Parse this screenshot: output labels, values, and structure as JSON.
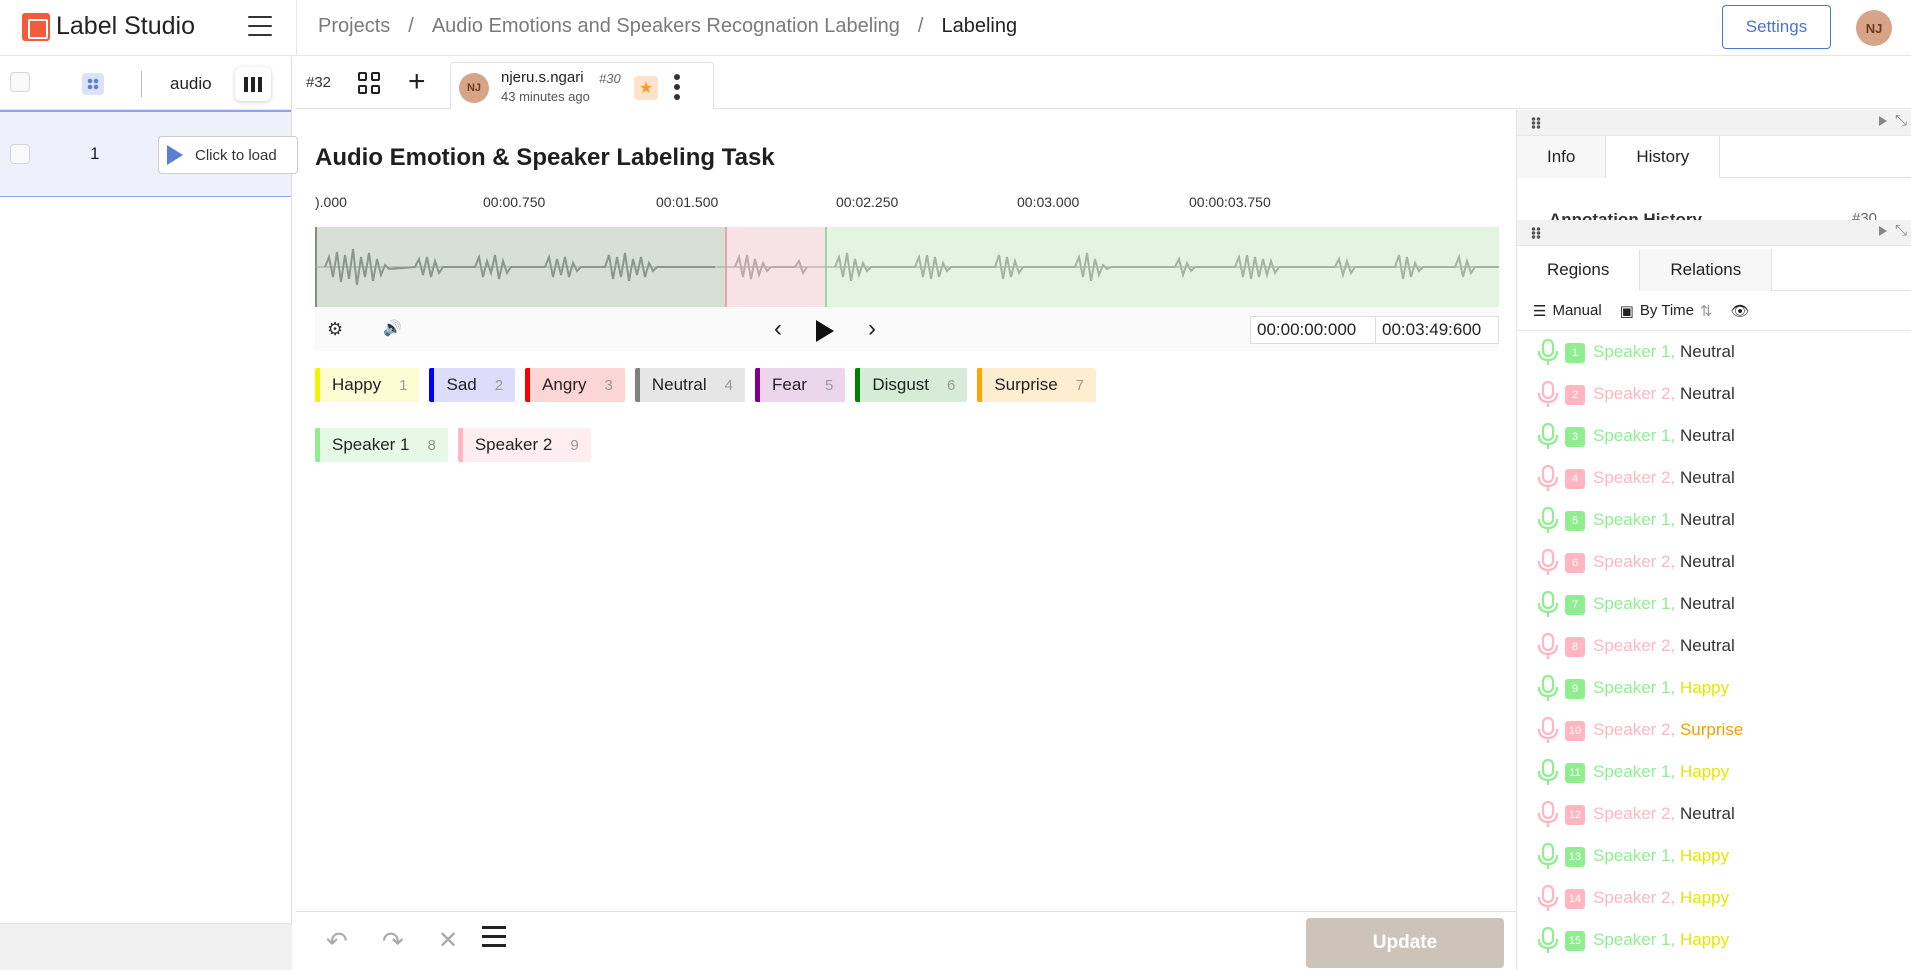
{
  "header": {
    "brand": "Label Studio",
    "breadcrumb": [
      "Projects",
      "Audio Emotions and Speakers Recognation Labeling",
      "Labeling"
    ],
    "settings_label": "Settings",
    "user_initials": "NJ"
  },
  "left_panel": {
    "column_label": "audio",
    "rows": [
      {
        "num": "1",
        "load_label": "Click to load"
      }
    ]
  },
  "annotation_bar": {
    "task_id": "#32",
    "annotator": "njeru.s.ngari",
    "annotation_id": "#30",
    "time": "43 minutes ago",
    "initials": "NJ"
  },
  "main": {
    "title": "Audio Emotion & Speaker Labeling Task",
    "timeline_labels": [
      ").000",
      "00:00.750",
      "00:01.500",
      "00:02.250",
      "00:03.000",
      "00:00:03.750"
    ],
    "time_current": "00:00:00:000",
    "time_total": "00:03:49:600"
  },
  "emotion_labels": [
    {
      "name": "Happy",
      "hotkey": "1",
      "color": "#f4f400",
      "bg": "#fdfdd4"
    },
    {
      "name": "Sad",
      "hotkey": "2",
      "color": "#0000ff",
      "bg": "#dcdcfb"
    },
    {
      "name": "Angry",
      "hotkey": "3",
      "color": "#ff0000",
      "bg": "#fcd6d6"
    },
    {
      "name": "Neutral",
      "hotkey": "4",
      "color": "#808080",
      "bg": "#e6e6e6"
    },
    {
      "name": "Fear",
      "hotkey": "5",
      "color": "#800080",
      "bg": "#ecd6ec"
    },
    {
      "name": "Disgust",
      "hotkey": "6",
      "color": "#008000",
      "bg": "#d6ecd6"
    },
    {
      "name": "Surprise",
      "hotkey": "7",
      "color": "#ffa500",
      "bg": "#ffedd0"
    }
  ],
  "speaker_labels": [
    {
      "name": "Speaker 1",
      "hotkey": "8",
      "color": "#90ee90",
      "bg": "#e6f9e6"
    },
    {
      "name": "Speaker 2",
      "hotkey": "9",
      "color": "#ffb6c1",
      "bg": "#ffeef1"
    }
  ],
  "bottom_bar": {
    "update_label": "Update"
  },
  "right_panel": {
    "top_tabs": [
      "Info",
      "History"
    ],
    "history_cut": "Annotation History",
    "history_cut_id": "#30",
    "region_tabs": [
      "Regions",
      "Relations"
    ],
    "sort_manual": "Manual",
    "sort_time": "By Time"
  },
  "regions": [
    {
      "num": "1",
      "speaker": "Speaker 1,",
      "emotion": "Neutral",
      "sp_color": "#90ee90",
      "em_color": "#333333"
    },
    {
      "num": "2",
      "speaker": "Speaker 2,",
      "emotion": "Neutral",
      "sp_color": "#ffb6c1",
      "em_color": "#333333"
    },
    {
      "num": "3",
      "speaker": "Speaker 1,",
      "emotion": "Neutral",
      "sp_color": "#90ee90",
      "em_color": "#333333"
    },
    {
      "num": "4",
      "speaker": "Speaker 2,",
      "emotion": "Neutral",
      "sp_color": "#ffb6c1",
      "em_color": "#333333"
    },
    {
      "num": "5",
      "speaker": "Speaker 1,",
      "emotion": "Neutral",
      "sp_color": "#90ee90",
      "em_color": "#333333"
    },
    {
      "num": "6",
      "speaker": "Speaker 2,",
      "emotion": "Neutral",
      "sp_color": "#ffb6c1",
      "em_color": "#333333"
    },
    {
      "num": "7",
      "speaker": "Speaker 1,",
      "emotion": "Neutral",
      "sp_color": "#90ee90",
      "em_color": "#333333"
    },
    {
      "num": "8",
      "speaker": "Speaker 2,",
      "emotion": "Neutral",
      "sp_color": "#ffb6c1",
      "em_color": "#333333"
    },
    {
      "num": "9",
      "speaker": "Speaker 1,",
      "emotion": "Happy",
      "sp_color": "#90ee90",
      "em_color": "#e6e600"
    },
    {
      "num": "10",
      "speaker": "Speaker 2,",
      "emotion": "Surprise",
      "sp_color": "#ffb6c1",
      "em_color": "#f0a000"
    },
    {
      "num": "11",
      "speaker": "Speaker 1,",
      "emotion": "Happy",
      "sp_color": "#90ee90",
      "em_color": "#e6e600"
    },
    {
      "num": "12",
      "speaker": "Speaker 2,",
      "emotion": "Neutral",
      "sp_color": "#ffb6c1",
      "em_color": "#333333"
    },
    {
      "num": "13",
      "speaker": "Speaker 1,",
      "emotion": "Happy",
      "sp_color": "#90ee90",
      "em_color": "#e6e600"
    },
    {
      "num": "14",
      "speaker": "Speaker 2,",
      "emotion": "Happy",
      "sp_color": "#ffb6c1",
      "em_color": "#e6e600"
    },
    {
      "num": "15",
      "speaker": "Speaker 1,",
      "emotion": "Happy",
      "sp_color": "#90ee90",
      "em_color": "#e6e600"
    }
  ]
}
